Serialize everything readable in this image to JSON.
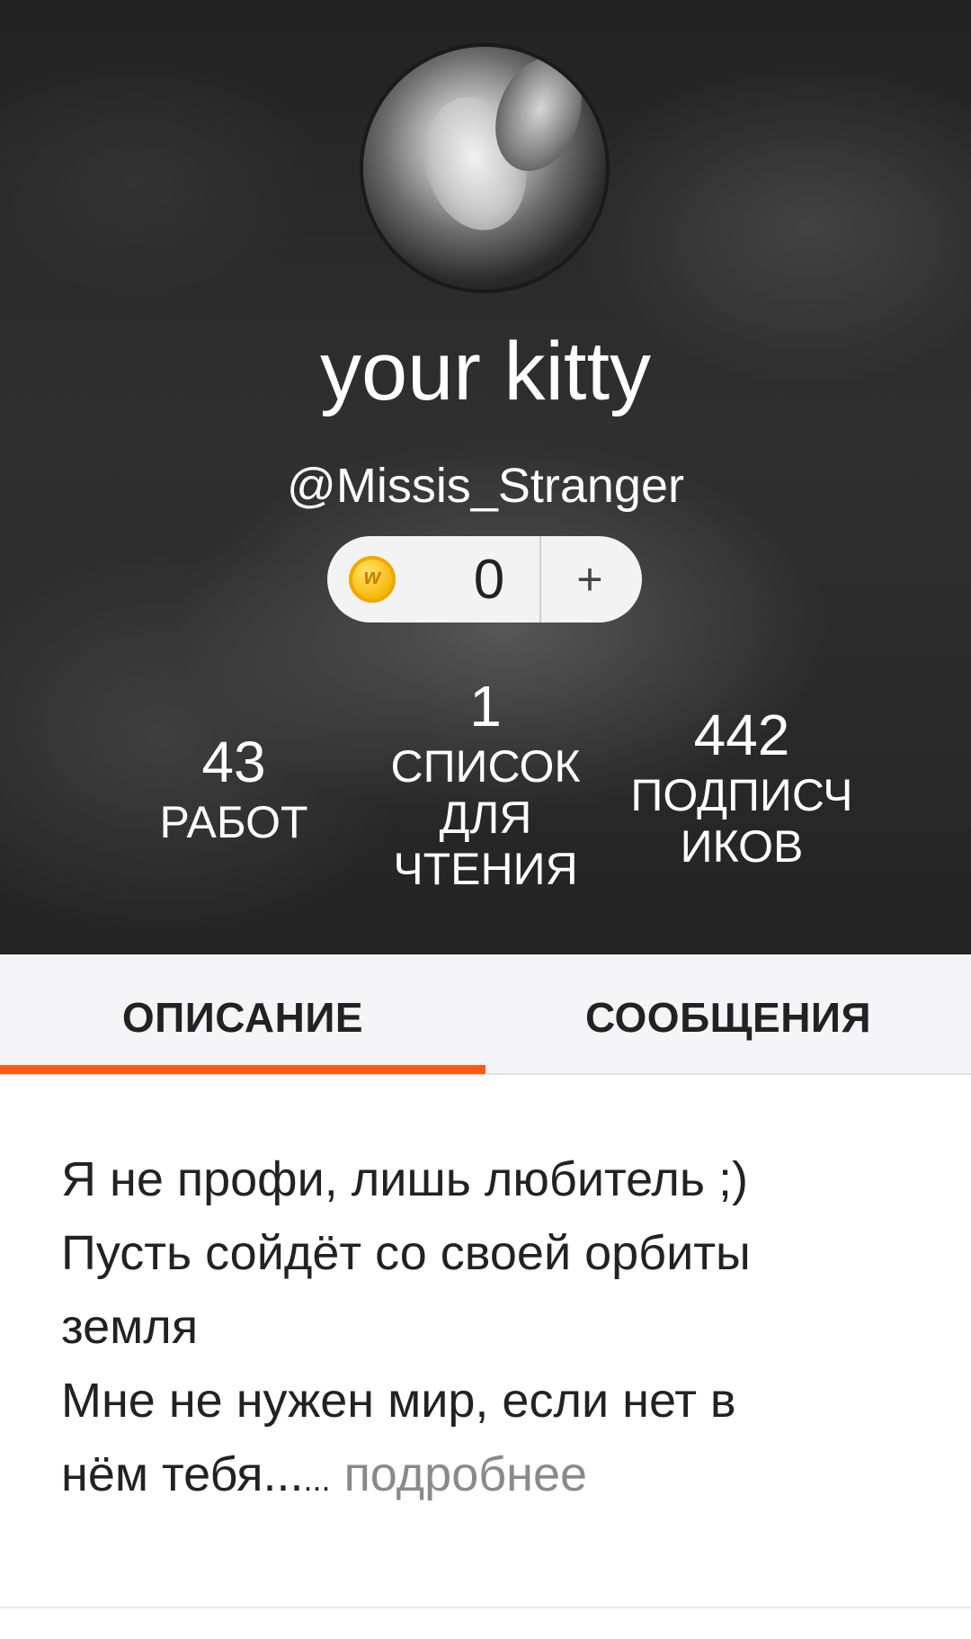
{
  "profile": {
    "display_name": "your kitty",
    "username": "@Missis_Stranger",
    "avatar_icon": "profile-photo"
  },
  "coins": {
    "icon": "wattpad-coin-icon",
    "count": "0",
    "add_label": "+"
  },
  "stats": {
    "works": {
      "count": "43",
      "label": "РАБОТ"
    },
    "reading_lists": {
      "count": "1",
      "label_lines": [
        "СПИСОК",
        "ДЛЯ",
        "ЧТЕНИЯ"
      ]
    },
    "followers": {
      "count": "442",
      "label_lines": [
        "ПОДПИСЧ",
        "ИКОВ"
      ]
    }
  },
  "tabs": {
    "description": "ОПИСАНИЕ",
    "messages": "СООБЩЕНИЯ",
    "active": "description",
    "accent_color": "#ff5a12"
  },
  "bio": {
    "lines": [
      "Я не профи, лишь любитель ;)",
      "Пусть сойдёт со своей орбиты",
      "земля",
      "Мне не нужен мир, если нет в",
      "нём тебя..."
    ],
    "ellipsis": "...",
    "more_link": "подробнее"
  }
}
